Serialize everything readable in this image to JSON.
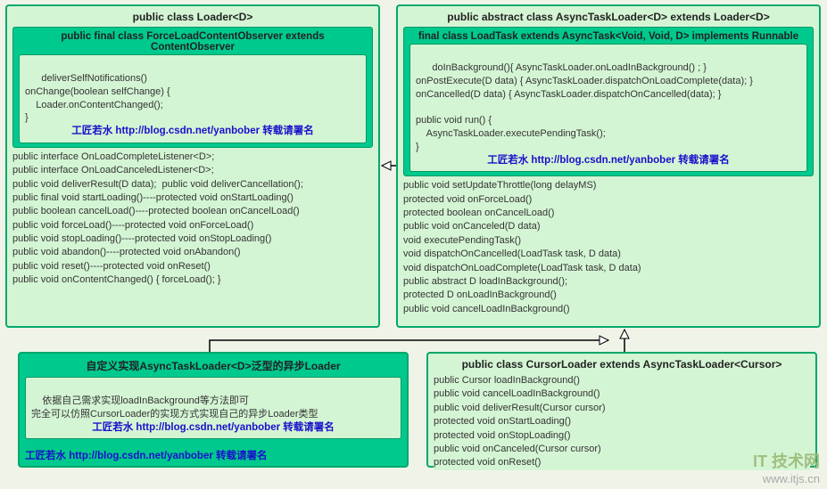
{
  "loader": {
    "title": "public class Loader<D>",
    "inner": {
      "title": "public final class ForceLoadContentObserver extends ContentObserver",
      "body": "deliverSelfNotifications()\nonChange(boolean selfChange) {\n    Loader.onContentChanged();\n}",
      "signature": "工匠若水 http://blog.csdn.net/yanbober 转载请署名"
    },
    "methods": "public interface OnLoadCompleteListener<D>;\npublic interface OnLoadCanceledListener<D>;\npublic void deliverResult(D data);  public void deliverCancellation();\npublic final void startLoading()----protected void onStartLoading()\npublic boolean cancelLoad()----protected boolean onCancelLoad()\npublic void forceLoad()----protected void onForceLoad()\npublic void stopLoading()----protected void onStopLoading()\npublic void abandon()----protected void onAbandon()\npublic void reset()----protected void onReset()\npublic void onContentChanged() { forceLoad(); }"
  },
  "async": {
    "title": "public abstract class AsyncTaskLoader<D> extends Loader<D>",
    "inner": {
      "title": "final class LoadTask extends AsyncTask<Void, Void, D> implements Runnable",
      "body": "doInBackground(){ AsyncTaskLoader.onLoadInBackground() ; }\nonPostExecute(D data) { AsyncTaskLoader.dispatchOnLoadComplete(data); }\nonCancelled(D data) { AsyncTaskLoader.dispatchOnCancelled(data); }\n\npublic void run() {\n    AsyncTaskLoader.executePendingTask();\n}",
      "signature": "工匠若水 http://blog.csdn.net/yanbober 转载请署名"
    },
    "methods": "public void setUpdateThrottle(long delayMS)\nprotected void onForceLoad()\nprotected boolean onCancelLoad()\npublic void onCanceled(D data)\nvoid executePendingTask()\nvoid dispatchOnCancelled(LoadTask task, D data)\nvoid dispatchOnLoadComplete(LoadTask task, D data)\npublic abstract D loadInBackground();\nprotected D onLoadInBackground()\npublic void cancelLoadInBackground()"
  },
  "custom": {
    "title": "自定义实现AsyncTaskLoader<D>泛型的异步Loader",
    "body": "依据自己需求实现loadInBackground等方法即可\n完全可以仿照CursorLoader的实现方式实现自己的异步Loader类型",
    "signature": "工匠若水 http://blog.csdn.net/yanbober 转载请署名",
    "signature2": "工匠若水 http://blog.csdn.net/yanbober 转载请署名"
  },
  "cursor": {
    "title": "public class CursorLoader extends AsyncTaskLoader<Cursor>",
    "methods": "public Cursor loadInBackground()\npublic void cancelLoadInBackground()\npublic void deliverResult(Cursor cursor)\nprotected void onStartLoading()\nprotected void onStopLoading()\npublic void onCanceled(Cursor cursor)\nprotected void onReset()"
  },
  "watermark": {
    "line1": "IT 技术网",
    "line2": "www.itjs.cn"
  }
}
